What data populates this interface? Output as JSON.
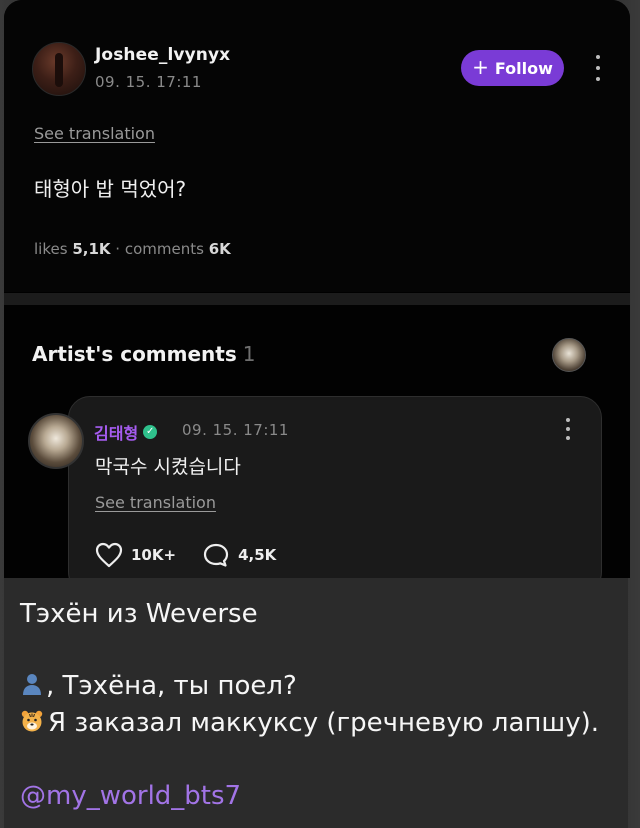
{
  "post": {
    "username": "Joshee_lvynyx",
    "timestamp": "09. 15. 17:11",
    "follow_label": "Follow",
    "see_translation": "See translation",
    "text": "태형아 밥 먹었어?",
    "stats": {
      "likes_label": "likes",
      "likes_value": "5,1K",
      "separator": "·",
      "comments_label": "comments",
      "comments_value": "6K"
    }
  },
  "artist_comments": {
    "title": "Artist's comments",
    "count": "1",
    "comment": {
      "author": "김태형",
      "timestamp": "09. 15. 17:11",
      "text": "막국수 시켰습니다",
      "see_translation": "See translation",
      "likes": "10K+",
      "replies": "4,5K"
    }
  },
  "caption": {
    "title": "Тэхён из Weverse",
    "line1": ", Тэхёна, ты поел?",
    "line2": "Я заказал маккуксу (гречневую лапшу).",
    "link": "@my_world_bts7"
  },
  "colors": {
    "follow_button": "#7a3bd6",
    "verified_badge": "#2fc18c",
    "author_name": "#a55cf0",
    "link": "#a274e6"
  }
}
